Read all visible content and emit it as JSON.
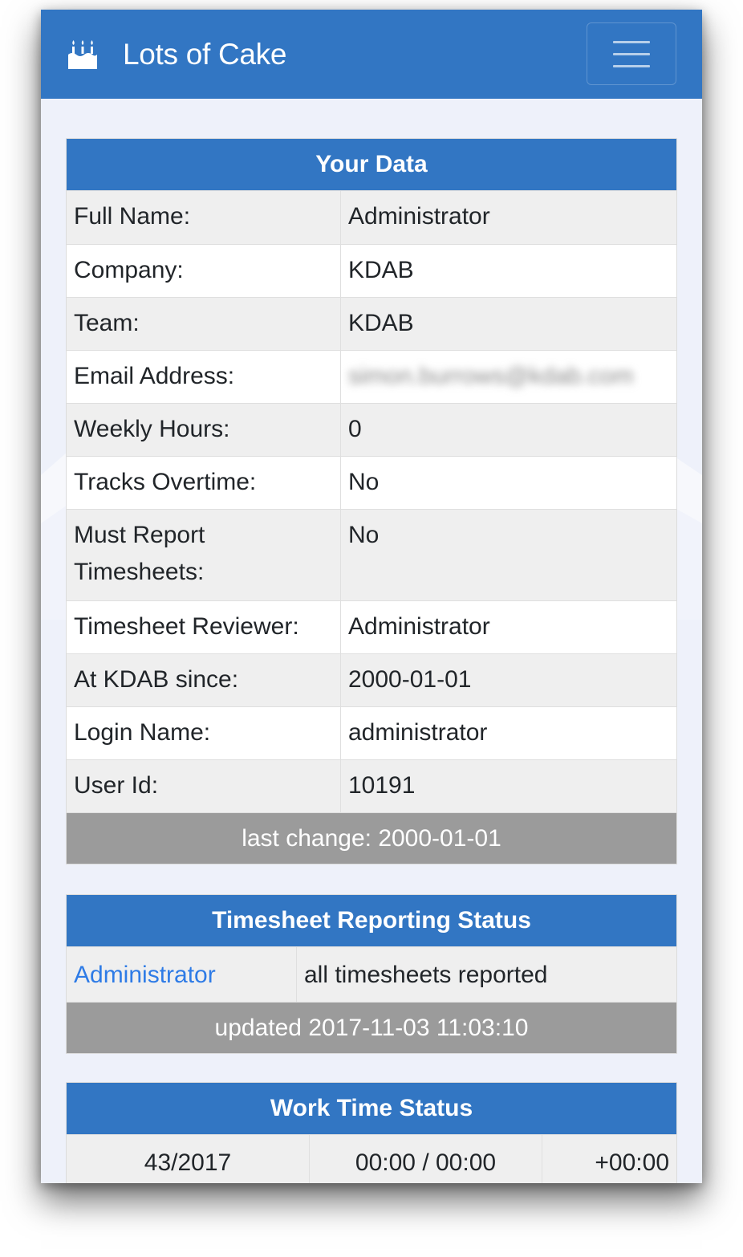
{
  "app": {
    "title": "Lots of Cake",
    "icon": "cake-icon"
  },
  "navbar": {
    "menu_icon": "hamburger-menu-icon",
    "background": "#3276c3"
  },
  "your_data": {
    "title": "Your Data",
    "rows": [
      {
        "label": "Full Name:",
        "value": "Administrator"
      },
      {
        "label": "Company:",
        "value": "KDAB"
      },
      {
        "label": "Team:",
        "value": "KDAB"
      },
      {
        "label": "Email Address:",
        "value": "simon.burrows@kdab.com"
      },
      {
        "label": "Weekly Hours:",
        "value": "0"
      },
      {
        "label": "Tracks Overtime:",
        "value": "No"
      },
      {
        "label": "Must Report Timesheets:",
        "value": "No"
      },
      {
        "label": "Timesheet Reviewer:",
        "value": "Administrator"
      },
      {
        "label": "At KDAB since:",
        "value": "2000-01-01"
      },
      {
        "label": "Login Name:",
        "value": "administrator"
      },
      {
        "label": "User Id:",
        "value": "10191"
      }
    ],
    "footer": "last change: 2000-01-01"
  },
  "timesheet_status": {
    "title": "Timesheet Reporting Status",
    "user": "Administrator",
    "status": "all timesheets reported",
    "footer": "updated 2017-11-03 11:03:10"
  },
  "work_time_status": {
    "title": "Work Time Status",
    "week": "43/2017",
    "hours": "00:00 / 00:00",
    "balance": "+00:00"
  },
  "colors": {
    "accent": "#3276c3",
    "footer": "#9b9b9b",
    "link": "#2e7be6"
  }
}
